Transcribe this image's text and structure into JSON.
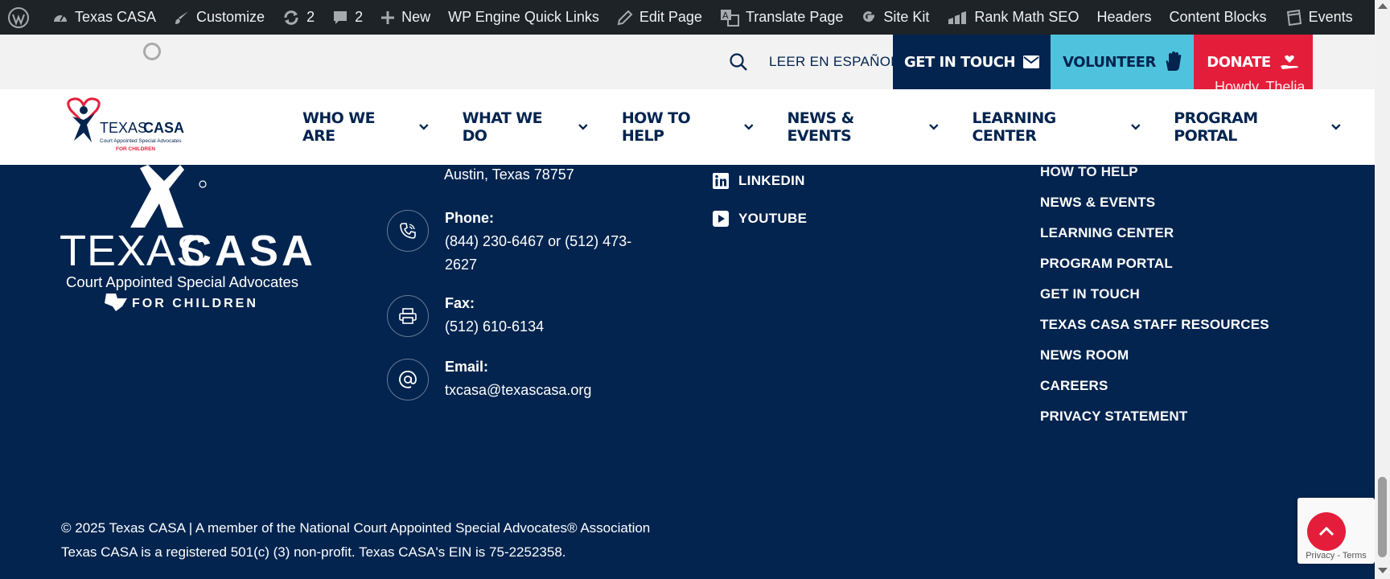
{
  "admin_bar": {
    "site_name": "Texas CASA",
    "customize": "Customize",
    "updates_count": "2",
    "comments_count": "2",
    "new_label": "New",
    "quick_links": "WP Engine Quick Links",
    "edit_page": "Edit Page",
    "translate_page": "Translate Page",
    "site_kit": "Site Kit",
    "rank_math": "Rank Math SEO",
    "headers": "Headers",
    "content_blocks": "Content Blocks",
    "events": "Events",
    "howdy": "Howdy, Thelia"
  },
  "utility": {
    "spanish": "LEER EN ESPAÑOL",
    "get_in_touch": "GET IN TOUCH",
    "volunteer": "VOLUNTEER",
    "donate": "DONATE"
  },
  "nav": {
    "items": [
      {
        "label": "WHO WE ARE"
      },
      {
        "label": "WHAT WE DO"
      },
      {
        "label": "HOW TO HELP"
      },
      {
        "label": "NEWS & EVENTS"
      },
      {
        "label": "LEARNING CENTER"
      },
      {
        "label": "PROGRAM PORTAL"
      }
    ]
  },
  "logo": {
    "word_a": "TEXAS",
    "word_b": "CASA",
    "tagline": "Court Appointed Special Advocates",
    "sub": "FOR CHILDREN"
  },
  "footer": {
    "address_line": "Austin, Texas 78757",
    "phone_label": "Phone:",
    "phone_value": "(844) 230-6467 or (512) 473-2627",
    "fax_label": "Fax:",
    "fax_value": "(512) 610-6134",
    "email_label": "Email:",
    "email_value": "txcasa@texascasa.org",
    "social": [
      {
        "label": "LINKEDIN"
      },
      {
        "label": "YOUTUBE"
      }
    ],
    "links": [
      {
        "label": "HOW TO HELP"
      },
      {
        "label": "NEWS & EVENTS"
      },
      {
        "label": "LEARNING CENTER"
      },
      {
        "label": "PROGRAM PORTAL"
      },
      {
        "label": "GET IN TOUCH"
      },
      {
        "label": "TEXAS CASA STAFF RESOURCES"
      },
      {
        "label": "NEWS ROOM"
      },
      {
        "label": "CAREERS"
      },
      {
        "label": "PRIVACY STATEMENT"
      }
    ],
    "copyright_1": "© 2025 Texas CASA | A member of the National Court Appointed Special Advocates® Association",
    "copyright_2": "Texas CASA is a registered 501(c) (3) non-profit. Texas CASA's EIN is 75-2252358."
  },
  "recaptcha": {
    "label": "Privacy - Terms"
  },
  "colors": {
    "navy": "#03244f",
    "red": "#e41e3a",
    "cyan": "#4fc3de",
    "admin_bar": "#1d2327"
  }
}
